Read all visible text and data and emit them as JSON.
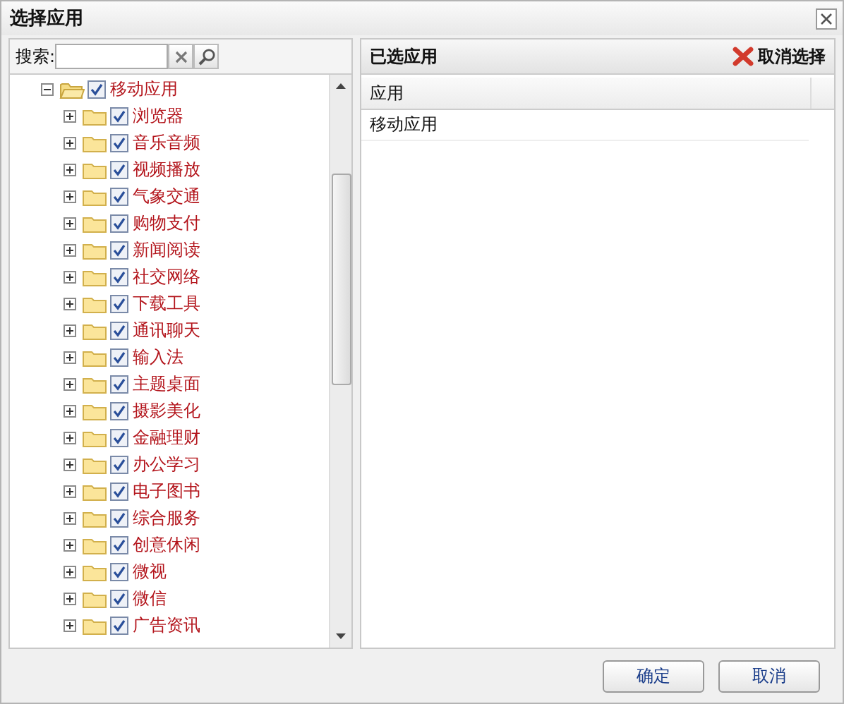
{
  "window": {
    "title": "选择应用"
  },
  "search": {
    "label": "搜索:"
  },
  "tree": {
    "label": "移动应用",
    "expanded": true,
    "checked": true,
    "children": [
      {
        "label": "浏览器",
        "expanded": false,
        "checked": true
      },
      {
        "label": "音乐音频",
        "expanded": false,
        "checked": true
      },
      {
        "label": "视频播放",
        "expanded": false,
        "checked": true
      },
      {
        "label": "气象交通",
        "expanded": false,
        "checked": true
      },
      {
        "label": "购物支付",
        "expanded": false,
        "checked": true
      },
      {
        "label": "新闻阅读",
        "expanded": false,
        "checked": true
      },
      {
        "label": "社交网络",
        "expanded": false,
        "checked": true
      },
      {
        "label": "下载工具",
        "expanded": false,
        "checked": true
      },
      {
        "label": "通讯聊天",
        "expanded": false,
        "checked": true
      },
      {
        "label": "输入法",
        "expanded": false,
        "checked": true
      },
      {
        "label": "主题桌面",
        "expanded": false,
        "checked": true
      },
      {
        "label": "摄影美化",
        "expanded": false,
        "checked": true
      },
      {
        "label": "金融理财",
        "expanded": false,
        "checked": true
      },
      {
        "label": "办公学习",
        "expanded": false,
        "checked": true
      },
      {
        "label": "电子图书",
        "expanded": false,
        "checked": true
      },
      {
        "label": "综合服务",
        "expanded": false,
        "checked": true
      },
      {
        "label": "创意休闲",
        "expanded": false,
        "checked": true
      },
      {
        "label": "微视",
        "expanded": false,
        "checked": true
      },
      {
        "label": "微信",
        "expanded": false,
        "checked": true
      },
      {
        "label": "广告资讯",
        "expanded": false,
        "checked": true
      }
    ]
  },
  "selected_panel": {
    "title": "已选应用",
    "clear_button": "取消选择",
    "columns": [
      "应用"
    ],
    "rows": [
      "移动应用"
    ]
  },
  "buttons": [
    "确定",
    "取消"
  ]
}
